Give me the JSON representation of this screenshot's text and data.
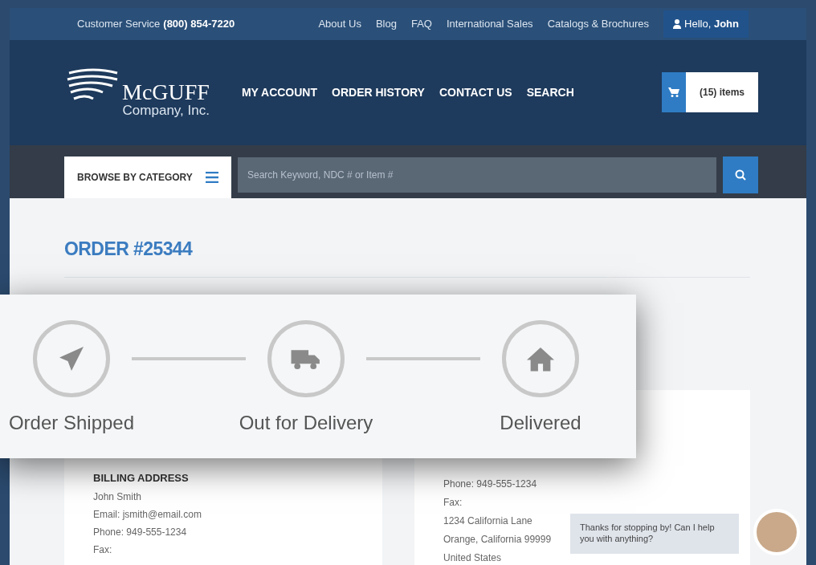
{
  "top_bar": {
    "service_label": "Customer Service",
    "phone": "(800) 854-7220",
    "links": [
      "About Us",
      "Blog",
      "FAQ",
      "International Sales",
      "Catalogs & Brochures"
    ],
    "greeting": "Hello, **John**"
  },
  "header": {
    "logo_name": "McGUFF",
    "logo_sub": "Company, Inc.",
    "nav": [
      "MY ACCOUNT",
      "ORDER HISTORY",
      "CONTACT US",
      "SEARCH"
    ],
    "cart": "(15) items"
  },
  "search_bar": {
    "browse": "BROWSE BY CATEGORY",
    "placeholder": "Search Keyword, NDC # or Item #"
  },
  "order": {
    "title": "ORDER #25344"
  },
  "tracker": {
    "steps": [
      {
        "kind": "shipped",
        "label": "Order Shipped"
      },
      {
        "kind": "truck",
        "label": "Out for Delivery"
      },
      {
        "kind": "home",
        "label": "Delivered"
      }
    ]
  },
  "billing": {
    "heading": "BILLING ADDRESS",
    "lines": [
      "John Smith",
      "Email: jsmith@email.com",
      "Phone: 949-555-1234",
      "Fax:"
    ]
  },
  "shipping": {
    "lines": [
      "Phone: 949-555-1234",
      "Fax:",
      "1234 California Lane",
      "Orange, California 99999",
      "United States"
    ]
  },
  "chat": {
    "message": "Thanks for stopping by! Can I help you with anything?"
  }
}
